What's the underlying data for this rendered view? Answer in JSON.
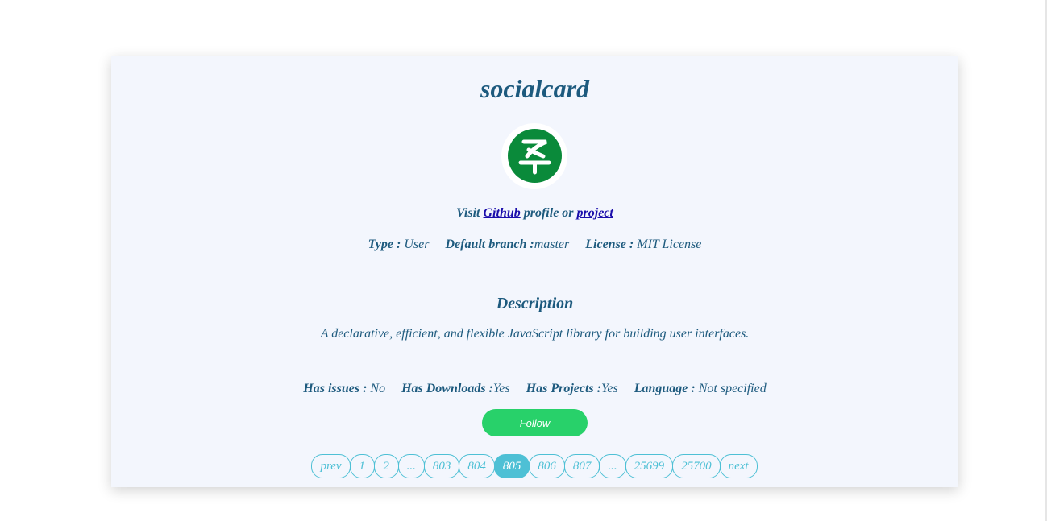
{
  "repo": {
    "name": "socialcard",
    "avatar_icon": "socialcard-logo-icon"
  },
  "visit": {
    "prefix": "Visit",
    "github_link": "Github",
    "middle": "profile or",
    "project_link": "project"
  },
  "meta": {
    "type_label": "Type :",
    "type_value": "User",
    "branch_label": "Default branch :",
    "branch_value": "master",
    "license_label": "License :",
    "license_value": "MIT License"
  },
  "description": {
    "heading": "Description",
    "text": "A declarative, efficient, and flexible JavaScript library for building user interfaces."
  },
  "flags": {
    "issues_label": "Has issues :",
    "issues_value": "No",
    "downloads_label": "Has Downloads :",
    "downloads_value": "Yes",
    "projects_label": "Has Projects :",
    "projects_value": "Yes",
    "language_label": "Language :",
    "language_value": "Not specified"
  },
  "follow_label": "Follow",
  "pagination": {
    "items": [
      "prev",
      "1",
      "2",
      "...",
      "803",
      "804",
      "805",
      "806",
      "807",
      "...",
      "25699",
      "25700",
      "next"
    ],
    "active": "805"
  },
  "colors": {
    "card_bg": "#f3f6fd",
    "text": "#1d5a7e",
    "follow": "#28d16a",
    "pager": "#4ec0d5",
    "avatar": "#0a8a3a"
  }
}
